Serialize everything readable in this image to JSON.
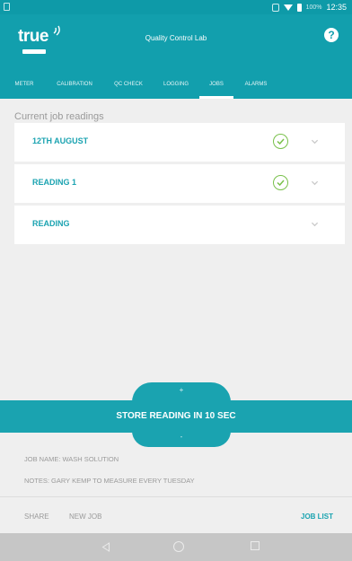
{
  "status_bar": {
    "battery_pct": "100%",
    "time": "12:35"
  },
  "app": {
    "logo_text": "true",
    "title": "Quality Control Lab",
    "help_label": "?"
  },
  "tabs": [
    {
      "label": "METER",
      "active": false
    },
    {
      "label": "CALIBRATION",
      "active": false
    },
    {
      "label": "QC CHECK",
      "active": false
    },
    {
      "label": "LOGGING",
      "active": false
    },
    {
      "label": "JOBS",
      "active": true
    },
    {
      "label": "ALARMS",
      "active": false
    }
  ],
  "readings": {
    "section_label": "Current job readings",
    "items": [
      {
        "label": "12TH AUGUST",
        "checked": true
      },
      {
        "label": "READING 1",
        "checked": true
      },
      {
        "label": "READING",
        "checked": false
      }
    ]
  },
  "store": {
    "increment_label": "+",
    "label": "STORE READING IN 10 SEC",
    "decrement_label": "-"
  },
  "job": {
    "name_line": "JOB NAME: WASH SOLUTION",
    "notes_line": "NOTES: GARY KEMP TO MEASURE EVERY TUESDAY"
  },
  "actions": {
    "share_label": "SHARE",
    "new_job_label": "NEW JOB",
    "job_list_label": "JOB LIST"
  },
  "colors": {
    "primary": "#129fad",
    "accent_text": "#1ba3b1",
    "check": "#79c14b",
    "background": "#efefef"
  }
}
